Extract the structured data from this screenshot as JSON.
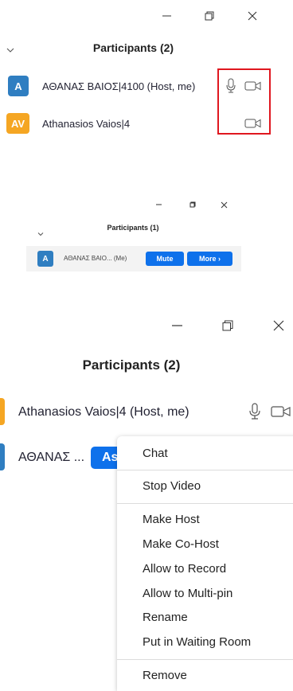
{
  "panel1": {
    "title": "Participants (2)",
    "participants": [
      {
        "initials": "A",
        "name": "ΑΘΑΝΑΣ ΒΑΙΟΣ|4100 (Host, me)",
        "avatar_color": "#2f7ec1"
      },
      {
        "initials": "AV",
        "name": "Athanasios Vaios|4",
        "avatar_color": "#f5a623"
      }
    ],
    "highlight_color": "#e0171f"
  },
  "panel2": {
    "title": "Participants (1)",
    "participant": {
      "initials": "A",
      "name": "ΑΘΑΝΑΣ ΒΑΙΟ... (Me)",
      "avatar_color": "#2f7ec1"
    },
    "mute_label": "Mute",
    "more_label": "More ›"
  },
  "panel3": {
    "title": "Participants (2)",
    "participants": [
      {
        "name": "Athanasios Vaios|4 (Host, me)",
        "avatar_color": "#f5a623"
      },
      {
        "name": "ΑΘΑΝΑΣ ...",
        "avatar_color": "#2f7ec1"
      }
    ],
    "button_partial": "As",
    "menu": [
      "Chat",
      "Stop Video",
      "Make Host",
      "Make Co-Host",
      "Allow to Record",
      "Allow to Multi-pin",
      "Rename",
      "Put in Waiting Room",
      "Remove"
    ]
  },
  "accent_color": "#0e71eb"
}
